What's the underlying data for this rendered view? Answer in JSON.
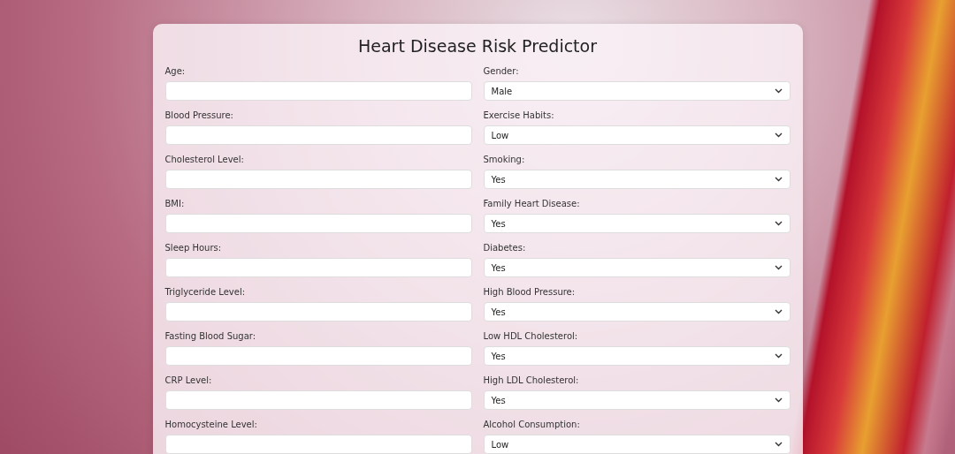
{
  "title": "Heart Disease Risk Predictor",
  "left_fields": [
    {
      "label": "Age:",
      "kind": "input"
    },
    {
      "label": "Blood Pressure:",
      "kind": "input"
    },
    {
      "label": "Cholesterol Level:",
      "kind": "input"
    },
    {
      "label": "BMI:",
      "kind": "input"
    },
    {
      "label": "Sleep Hours:",
      "kind": "input"
    },
    {
      "label": "Triglyceride Level:",
      "kind": "input"
    },
    {
      "label": "Fasting Blood Sugar:",
      "kind": "input"
    },
    {
      "label": "CRP Level:",
      "kind": "input"
    },
    {
      "label": "Homocysteine Level:",
      "kind": "input"
    }
  ],
  "right_fields": [
    {
      "label": "Gender:",
      "kind": "select",
      "value": "Male"
    },
    {
      "label": "Exercise Habits:",
      "kind": "select",
      "value": "Low"
    },
    {
      "label": "Smoking:",
      "kind": "select",
      "value": "Yes"
    },
    {
      "label": "Family Heart Disease:",
      "kind": "select",
      "value": "Yes"
    },
    {
      "label": "Diabetes:",
      "kind": "select",
      "value": "Yes"
    },
    {
      "label": "High Blood Pressure:",
      "kind": "select",
      "value": "Yes"
    },
    {
      "label": "Low HDL Cholesterol:",
      "kind": "select",
      "value": "Yes"
    },
    {
      "label": "High LDL Cholesterol:",
      "kind": "select",
      "value": "Yes"
    },
    {
      "label": "Alcohol Consumption:",
      "kind": "select",
      "value": "Low"
    }
  ]
}
